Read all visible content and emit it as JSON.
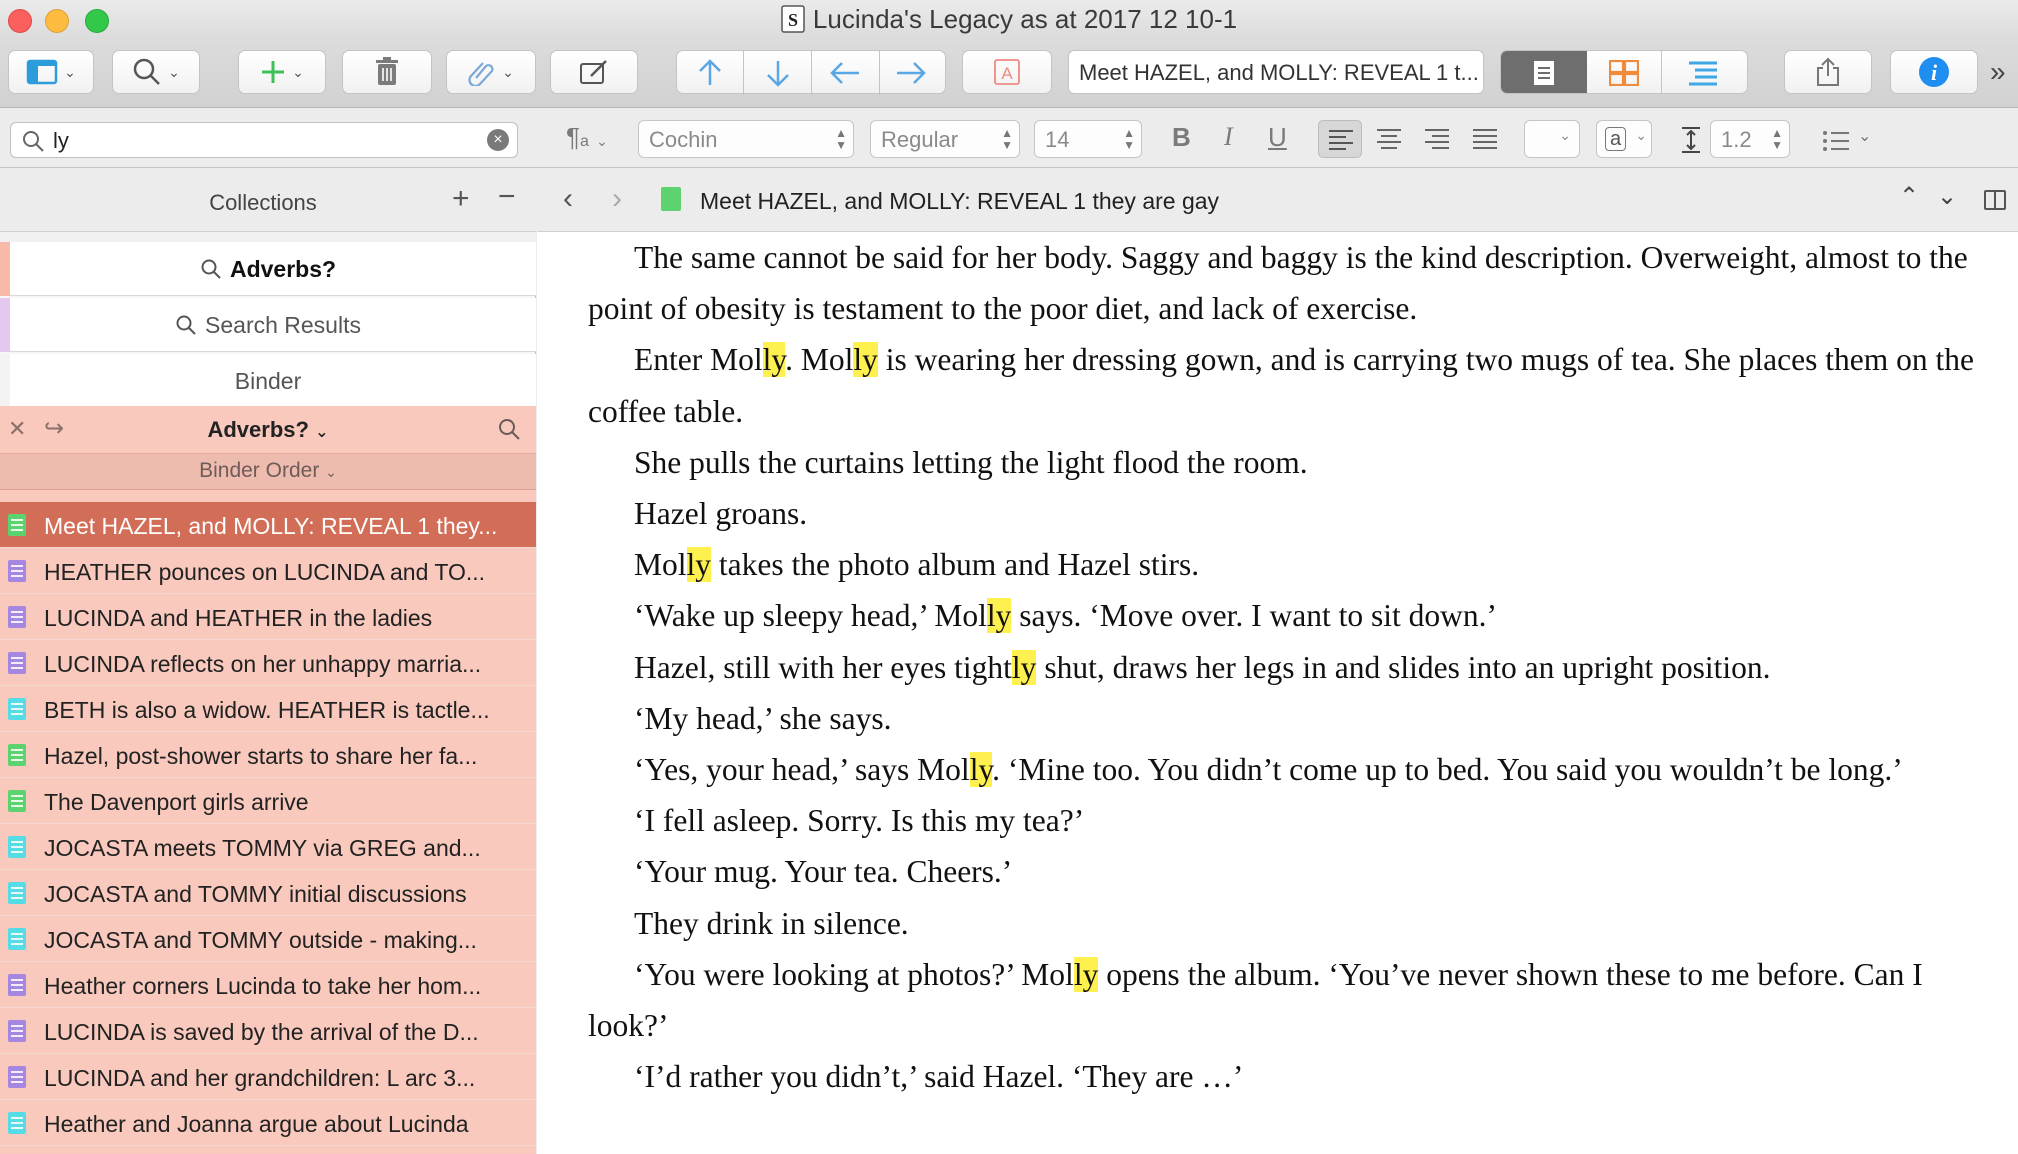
{
  "window": {
    "title": "Lucinda's Legacy as at 2017 12 10-1"
  },
  "toolbar": {
    "document_title": "Meet HAZEL, and MOLLY: REVEAL 1 t...",
    "icons": [
      "binder-view-icon",
      "search-icon",
      "add-icon",
      "trash-icon",
      "attachment-icon",
      "compose-icon",
      "move-up-icon",
      "move-down-icon",
      "move-left-icon",
      "move-right-icon",
      "format-icon",
      "document-mode-icon",
      "corkboard-mode-icon",
      "outline-mode-icon",
      "share-icon",
      "info-icon"
    ],
    "overflow": "»"
  },
  "search": {
    "value": "ly",
    "clear": "×"
  },
  "format_bar": {
    "font": "Cochin",
    "style": "Regular",
    "size": "14",
    "bold": "B",
    "italic": "I",
    "underline": "U",
    "line_spacing": "1.2",
    "text_color": "a"
  },
  "collections": {
    "header": "Collections",
    "add": "+",
    "remove": "−",
    "items": [
      {
        "label": "Adverbs?",
        "active": true,
        "stripe": "#f7b9a8"
      },
      {
        "label": "Search Results",
        "active": false,
        "stripe": "#e4c8f2"
      },
      {
        "label": "Binder",
        "active": false,
        "stripe": "#f3f3f3"
      }
    ]
  },
  "list": {
    "title": "Adverbs?",
    "order_label": "Binder Order",
    "rows": [
      {
        "text": "Meet HAZEL, and MOLLY: REVEAL 1 they...",
        "color": "#5dd36f",
        "selected": true
      },
      {
        "text": "HEATHER pounces on LUCINDA and TO...",
        "color": "#a586e0",
        "selected": false
      },
      {
        "text": "LUCINDA and HEATHER in the ladies",
        "color": "#a586e0",
        "selected": false
      },
      {
        "text": "LUCINDA reflects on her unhappy marria...",
        "color": "#a586e0",
        "selected": false
      },
      {
        "text": "BETH is also a widow. HEATHER is tactle...",
        "color": "#56dce5",
        "selected": false
      },
      {
        "text": "Hazel, post-shower starts to share her fa...",
        "color": "#5dd36f",
        "selected": false
      },
      {
        "text": "The Davenport girls arrive",
        "color": "#5dd36f",
        "selected": false
      },
      {
        "text": "JOCASTA meets TOMMY via GREG and...",
        "color": "#56dce5",
        "selected": false
      },
      {
        "text": "JOCASTA and TOMMY initial discussions",
        "color": "#56dce5",
        "selected": false
      },
      {
        "text": "JOCASTA and TOMMY outside - making...",
        "color": "#56dce5",
        "selected": false
      },
      {
        "text": "Heather corners Lucinda to take her hom...",
        "color": "#a586e0",
        "selected": false
      },
      {
        "text": "LUCINDA is saved by the arrival of the D...",
        "color": "#a586e0",
        "selected": false
      },
      {
        "text": "LUCINDA and her grandchildren: L arc 3...",
        "color": "#a586e0",
        "selected": false
      },
      {
        "text": "Heather and Joanna argue about Lucinda",
        "color": "#56dce5",
        "selected": false
      }
    ]
  },
  "editor": {
    "doc_title": "Meet HAZEL, and MOLLY: REVEAL 1 they are gay",
    "paragraphs": [
      [
        {
          "t": "The same cannot be said for her body. Saggy and baggy is the kind description. Overweight, almost to the point of obesity is testament to the poor diet, and lack of exercise."
        }
      ],
      [
        {
          "t": "Enter Mol"
        },
        {
          "t": "ly",
          "h": true
        },
        {
          "t": ". Mol"
        },
        {
          "t": "ly",
          "h": true
        },
        {
          "t": " is wearing her dressing gown, and is carrying two mugs of tea. She places them on the coffee table."
        }
      ],
      [
        {
          "t": "She pulls the curtains letting the light flood the room."
        }
      ],
      [
        {
          "t": "Hazel groans."
        }
      ],
      [
        {
          "t": "Mol"
        },
        {
          "t": "ly",
          "h": true
        },
        {
          "t": " takes the photo album and Hazel stirs."
        }
      ],
      [
        {
          "t": "‘Wake up sleepy head,’ Mol"
        },
        {
          "t": "ly",
          "h": true
        },
        {
          "t": " says. ‘Move over. I want to sit down.’"
        }
      ],
      [
        {
          "t": "Hazel, still with her eyes tight"
        },
        {
          "t": "ly",
          "h": true
        },
        {
          "t": " shut, draws her legs in and slides into an upright position."
        }
      ],
      [
        {
          "t": "‘My head,’ she says."
        }
      ],
      [
        {
          "t": "‘Yes, your head,’ says Mol"
        },
        {
          "t": "ly",
          "h": true
        },
        {
          "t": ". ‘Mine too. You didn’t come up to bed. You said you wouldn’t be long.’"
        }
      ],
      [
        {
          "t": "‘I fell asleep. Sorry. Is this my tea?’"
        }
      ],
      [
        {
          "t": "‘Your mug. Your tea. Cheers.’"
        }
      ],
      [
        {
          "t": "They drink in silence."
        }
      ],
      [
        {
          "t": "‘You were looking at photos?’ Mol"
        },
        {
          "t": "ly",
          "h": true
        },
        {
          "t": " opens the album. ‘You’ve never shown these to me before. Can I look?’"
        }
      ],
      [
        {
          "t": "‘I’d rather you didn’t,’ said Hazel. ‘They are …’"
        }
      ]
    ]
  }
}
